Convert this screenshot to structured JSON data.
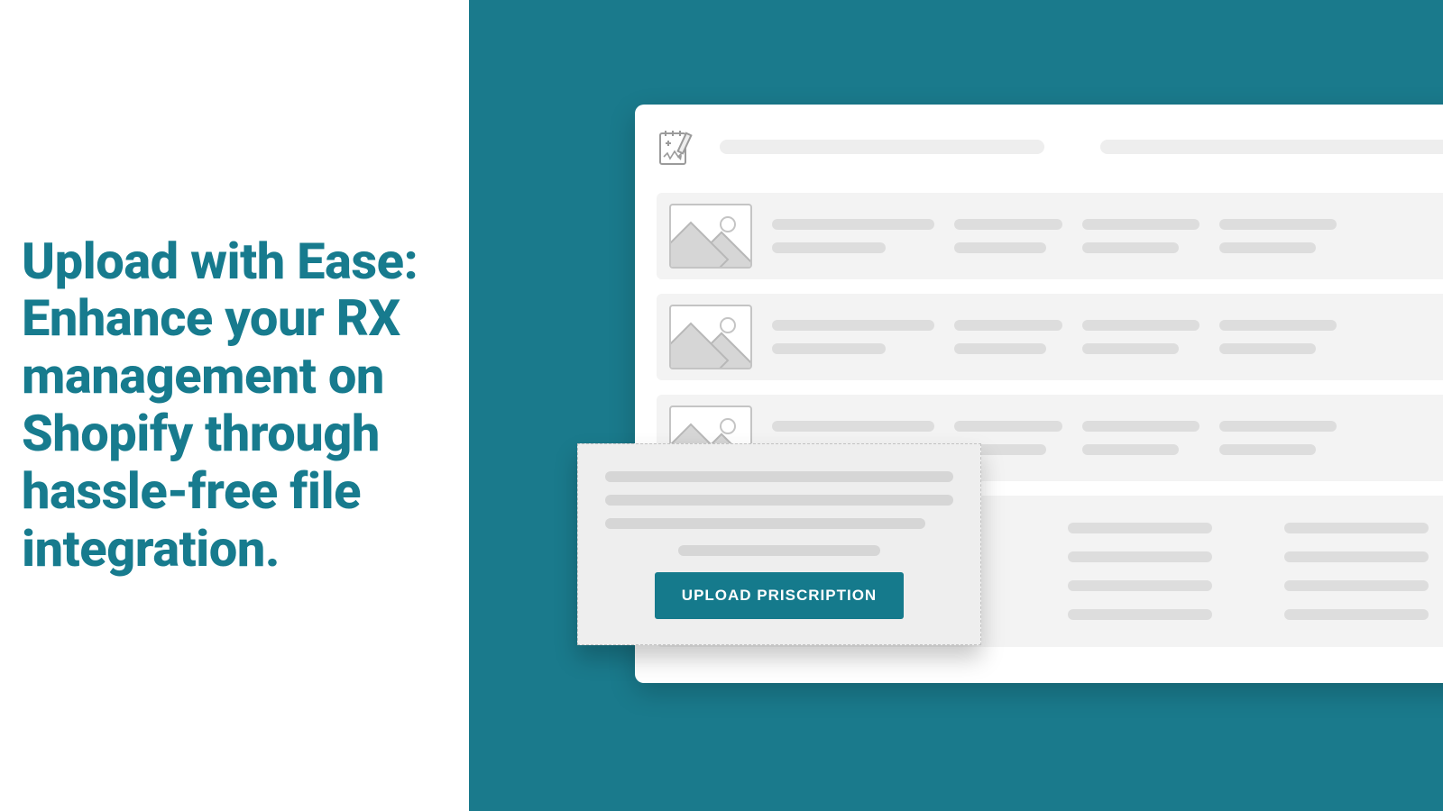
{
  "headline": "Upload with Ease: Enhance your RX management on Shopify through hassle-free file integration.",
  "upload_button_label": "UPLOAD PRISCRIPTION",
  "colors": {
    "brand": "#157a8c",
    "bg_teal": "#1a7a8c",
    "headline": "#177b8e"
  }
}
